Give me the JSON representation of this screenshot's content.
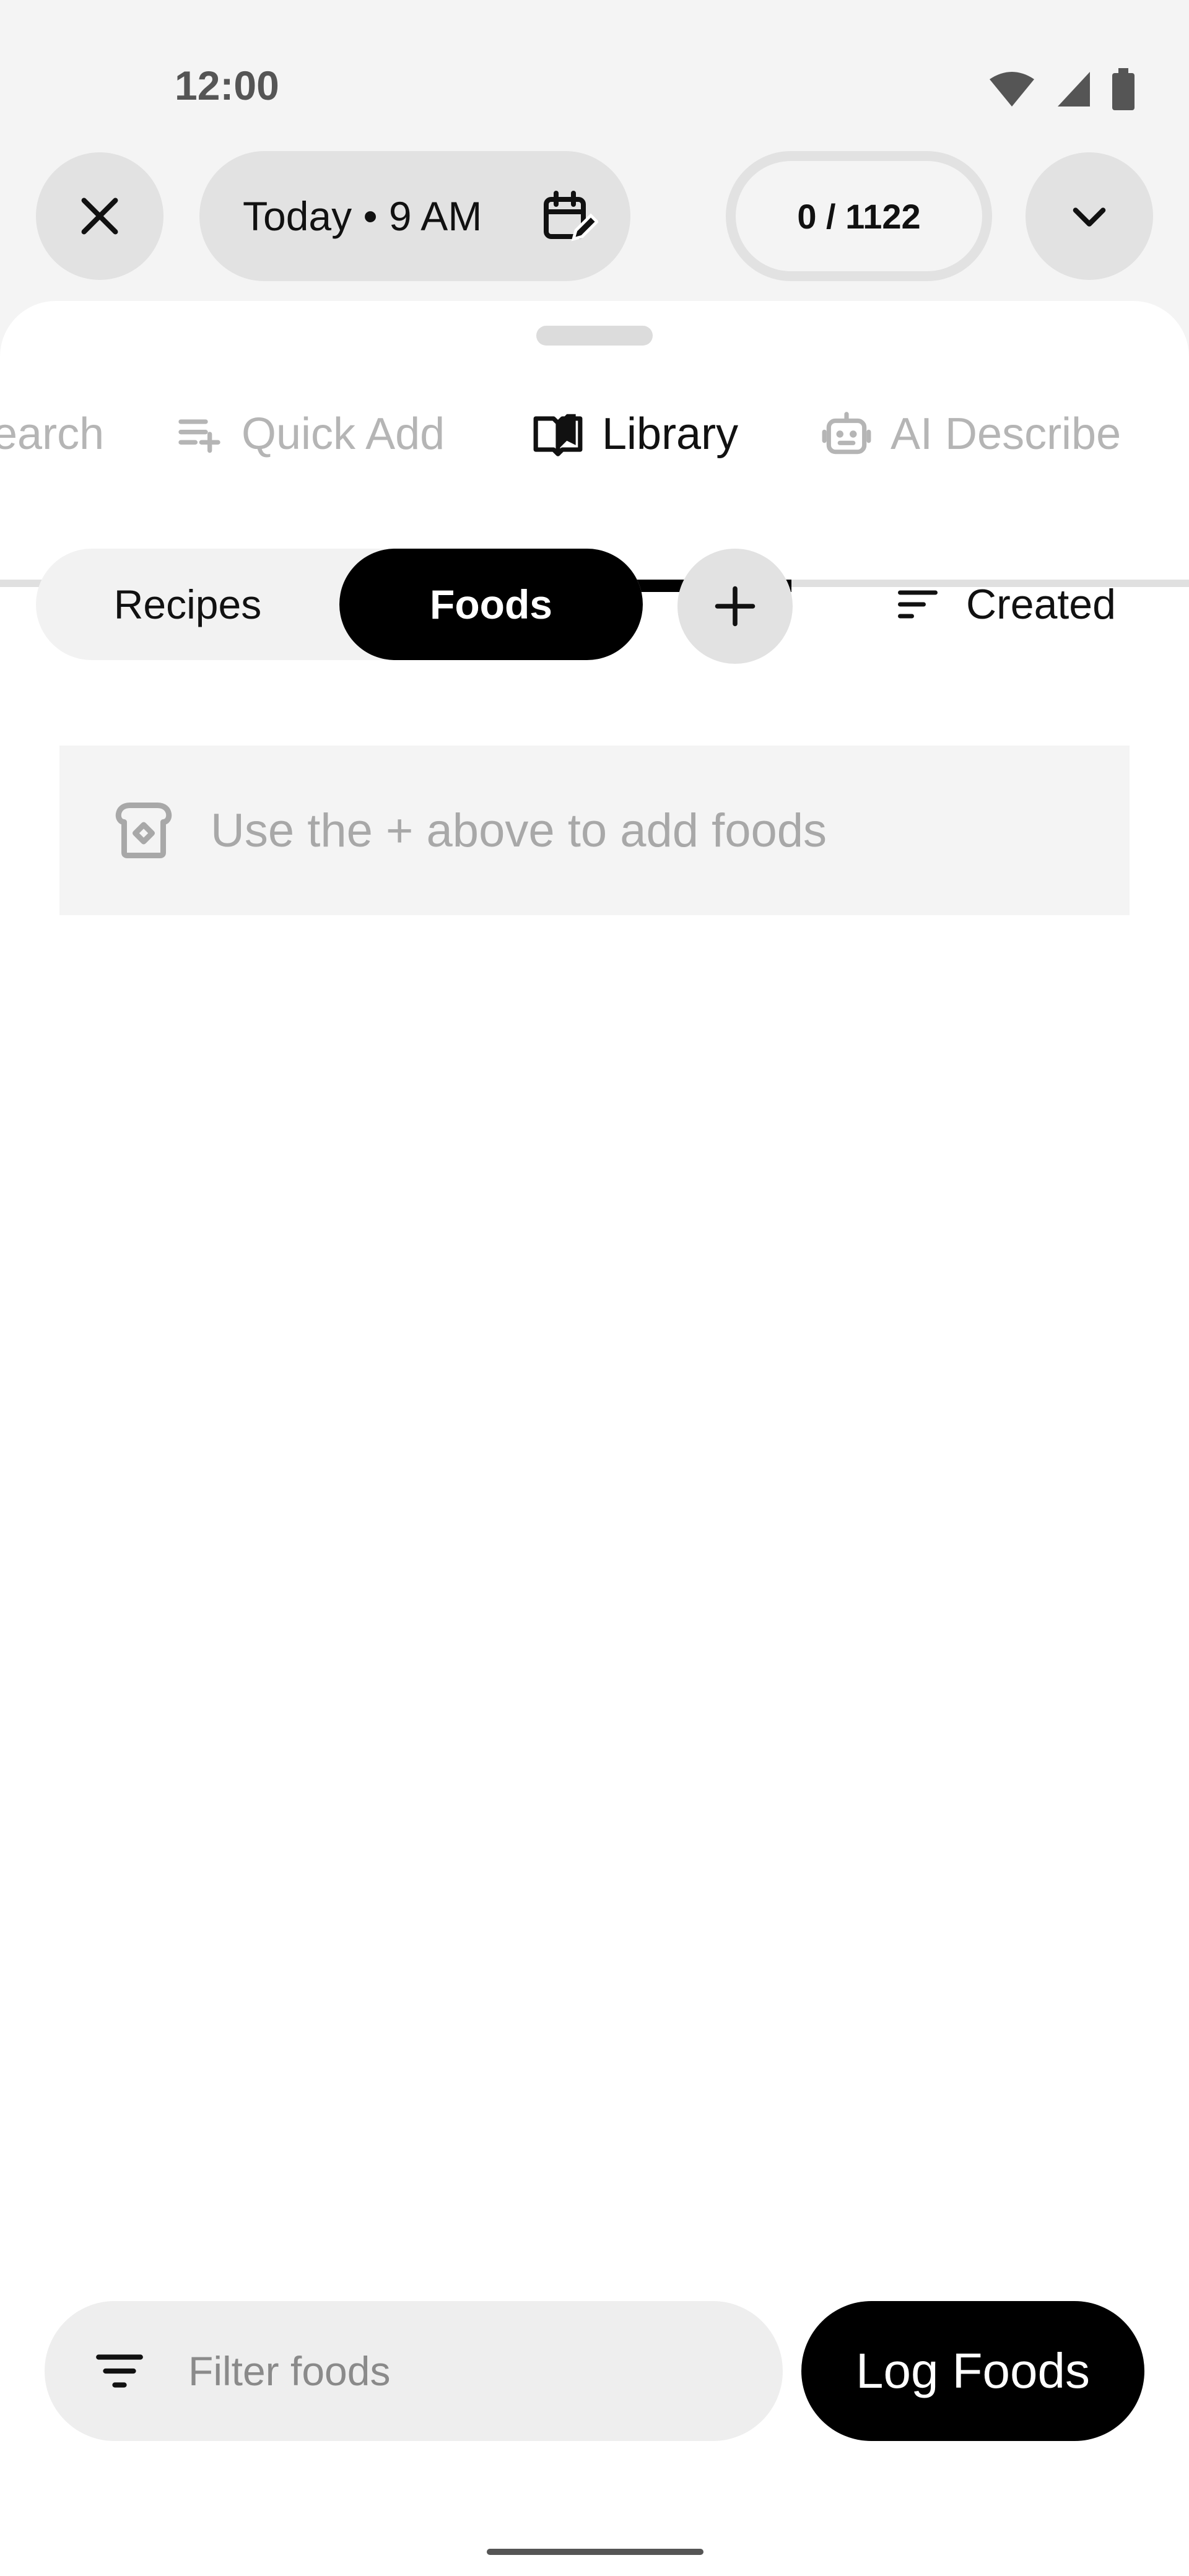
{
  "status_bar": {
    "time": "12:00"
  },
  "header": {
    "date_label": "Today • 9 AM",
    "counter": "0 / 1122"
  },
  "tabs": [
    {
      "label": "Search",
      "visible_text": "earch",
      "icon": "search-icon",
      "active": false
    },
    {
      "label": "Quick Add",
      "visible_text": "Quick Add",
      "icon": "playlist-add-icon",
      "active": false
    },
    {
      "label": "Library",
      "visible_text": "Library",
      "icon": "book-open-icon",
      "active": true
    },
    {
      "label": "AI Describe",
      "visible_text": "AI Describe",
      "icon": "robot-icon",
      "active": false
    }
  ],
  "library": {
    "segments": {
      "recipes": "Recipes",
      "foods": "Foods",
      "selected": "Foods"
    },
    "sort_label": "Created",
    "empty_message": "Use the + above to add foods"
  },
  "bottom_bar": {
    "filter_placeholder": "Filter foods",
    "log_button": "Log Foods"
  },
  "colors": {
    "background": "#f4f4f4",
    "sheet": "#ffffff",
    "accent": "#000000",
    "pill": "#e2e2e2",
    "muted_text": "#b5b5b5"
  }
}
